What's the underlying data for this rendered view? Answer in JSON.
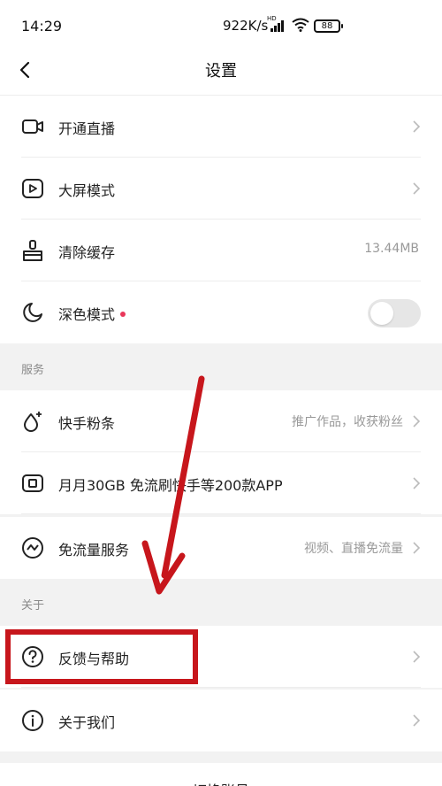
{
  "status_bar": {
    "time": "14:29",
    "network_speed": "922K/s",
    "network_badge": "HD",
    "battery": "88"
  },
  "header": {
    "title": "设置"
  },
  "items": [
    {
      "label": "开通直播",
      "icon": "camera-icon"
    },
    {
      "label": "大屏模式",
      "icon": "play-screen-icon"
    },
    {
      "label": "清除缓存",
      "icon": "broom-icon",
      "value": "13.44MB"
    },
    {
      "label": "深色模式",
      "icon": "moon-icon",
      "toggle": false
    }
  ],
  "sections": {
    "services": "服务",
    "about": "关于"
  },
  "service_items": [
    {
      "label": "快手粉条",
      "icon": "sparkle-drop-icon",
      "value": "推广作品，收获粉丝"
    },
    {
      "label": "月月30GB 免流刷快手等200款APP",
      "icon": "sim-card-icon"
    },
    {
      "label": "免流量服务",
      "icon": "wave-circle-icon",
      "value": "视频、直播免流量"
    }
  ],
  "about_items": [
    {
      "label": "反馈与帮助",
      "icon": "question-circle-icon"
    },
    {
      "label": "关于我们",
      "icon": "info-circle-icon"
    }
  ],
  "bottom": {
    "label": "切换账号"
  },
  "colors": {
    "accent_dot": "#e9375a",
    "annotation": "#c7161c"
  }
}
